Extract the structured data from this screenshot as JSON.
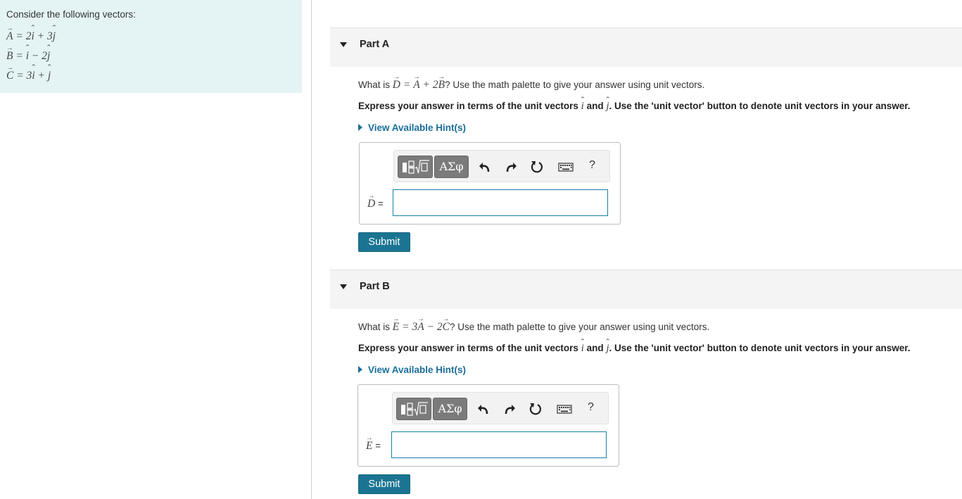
{
  "intro": {
    "text": "Consider the following vectors:",
    "vectors": [
      {
        "name": "A",
        "expr": [
          "2",
          "i",
          "+ 3",
          "j"
        ]
      },
      {
        "name": "B",
        "expr": [
          "",
          "i",
          "− 2",
          "j"
        ]
      },
      {
        "name": "C",
        "expr": [
          "3",
          "i",
          "+ ",
          "j"
        ]
      }
    ]
  },
  "parts": [
    {
      "title": "Part A",
      "question_prefix": "What is",
      "lhs": "D",
      "rhs_a": "A",
      "rhs_op": "+ 2",
      "rhs_b": "B",
      "question_suffix": "? Use the math palette to give your answer using unit vectors.",
      "instruction": {
        "pre": "Express your answer in terms of the unit vectors",
        "i": "i",
        "mid": "and",
        "j": "j",
        "post": ". Use the 'unit vector' button to denote unit vectors in your answer."
      },
      "hint": "View Available Hint(s)",
      "var_name": "D",
      "var_eq": "=",
      "input_value": "",
      "submit": "Submit"
    },
    {
      "title": "Part B",
      "question_prefix": "What is",
      "lhs": "E",
      "rhs_a": "A",
      "rhs_op": "− 2",
      "rhs_b": "C",
      "rhs_coef": "3",
      "question_suffix": "? Use the math palette to give your answer using unit vectors.",
      "instruction": {
        "pre": "Express your answer in terms of the unit vectors",
        "i": "i",
        "mid": "and",
        "j": "j",
        "post": ". Use the 'unit vector' button to denote unit vectors in your answer."
      },
      "hint": "View Available Hint(s)",
      "var_name": "E",
      "var_eq": "=",
      "input_value": "",
      "submit": "Submit"
    }
  ],
  "toolbar": {
    "greek_label": "ΑΣφ",
    "help_label": "?",
    "icons": [
      "templates-icon",
      "undo-icon",
      "redo-icon",
      "reset-icon",
      "keyboard-icon",
      "help-icon"
    ]
  },
  "colors": {
    "intro_bg": "#e4f4f5",
    "accent": "#1b7592",
    "hint": "#1a6e99",
    "toolbar_btn": "#7b7b7b"
  }
}
